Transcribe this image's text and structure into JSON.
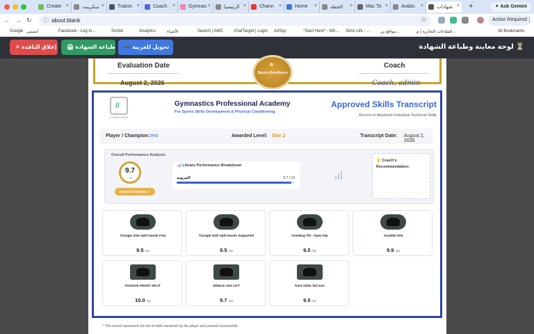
{
  "browser": {
    "tabs": [
      {
        "label": "Create",
        "color": "#7b5"
      },
      {
        "label": "سكريبت",
        "color": "#888"
      },
      {
        "label": "Trainin",
        "color": "#456"
      },
      {
        "label": "Coach",
        "color": "#5566dd"
      },
      {
        "label": "Gymnas",
        "color": "#e8a"
      },
      {
        "label": "الرئيسيا",
        "color": "#888"
      },
      {
        "label": "Chann",
        "color": "#e33"
      },
      {
        "label": "Home",
        "color": "#3a7bd5"
      },
      {
        "label": "الخطه",
        "color": "#888"
      },
      {
        "label": "Mac To",
        "color": "#666"
      },
      {
        "label": "Arabic",
        "color": "#888"
      },
      {
        "label": "شهادات",
        "color": "#555"
      }
    ],
    "new_tab_label": "+",
    "gemini_label": "Ask Gemini",
    "address": "about:blank",
    "action_required": "Action Required",
    "bookmarks": [
      "Google",
      "انستبي",
      "Facebook - Log In...",
      "Scribd",
      "Analytics",
      "الأشياء",
      "Search | AMC",
      "ChatTarget | Login",
      "AdSpy",
      "*Start Here* - Wh...",
      "Simo Life - ...",
      "مواقع بي...",
      "الفقاعات التجارية | م..."
    ],
    "all_bookmarks": "All Bookmarks"
  },
  "header": {
    "close_label": "✕  إغلاق النافذة",
    "print_label": "🖨  طباعة الشهادة",
    "convert_label": "➖ تحويل للعربية",
    "title": "لوحة معاينة وطباعة الشهادة ⏳"
  },
  "previous_cert": {
    "eval_label": "Evaluation Date",
    "eval_date": "August 2, 2026",
    "coach_label": "Coach",
    "coach_name": "Coach, admin",
    "seal_text": "Sports Excellence"
  },
  "transcript": {
    "logo_text": "COACH BIO",
    "academy_name": "Gymnastics Professional Academy",
    "academy_sub": "For Sports Skills Development & Physical Conditioning",
    "title": "Approved Skills Transcript",
    "subtitle": "Record of Mastered Individual Technical Skills",
    "player_label": "Player / Champion:",
    "player_value": "test",
    "level_label": "Awarded Level:",
    "level_value": "Star 2",
    "date_label": "Transcript Date:",
    "date_value": "August 2, 2026",
    "perf_title": "Overall Performance Analysis",
    "score": "9.7",
    "score_max": "/ 10",
    "badge": "Golden Champion ✦",
    "library_title": "📊 Library Performance Breakdown",
    "library_skill": "المرونه",
    "library_value": "9.7 / 10",
    "library_fraction": 0.97,
    "recommendation_title": "💡 Coach's Recommendation:",
    "skills": [
      {
        "name": "Triangle Side Split Hands Free",
        "score": "9.5",
        "max": "/10"
      },
      {
        "name": "Triangle Side Split Hands Supported",
        "score": "9.5",
        "max": "/10"
      },
      {
        "name": "Kneeling Tilt - Open Hip",
        "score": "9.5",
        "max": "/10"
      },
      {
        "name": "straddle fold",
        "score": "9.9",
        "max": "/10"
      },
      {
        "name": "PASSIVE FRONT SPLIT",
        "score": "10.0",
        "max": "/10"
      },
      {
        "name": "SINGLE LEG LIFT",
        "score": "9.7",
        "max": "/10"
      },
      {
        "name": "front slider fall outs",
        "score": "9.5",
        "max": "/10"
      }
    ],
    "footer_note": "* This record represents the list of skills mastered by the player and passed successfully."
  }
}
